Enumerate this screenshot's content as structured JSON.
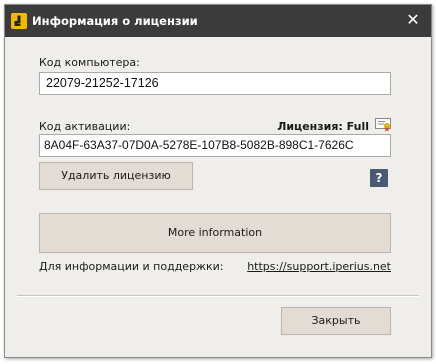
{
  "window": {
    "title": "Информация о лицензии",
    "close_glyph": "✕"
  },
  "computer_code": {
    "label": "Код компьютера:",
    "value": "22079-21252-17126"
  },
  "activation": {
    "label": "Код активации:",
    "license_status": "Лицензия: Full",
    "value": "8A04F-63A37-07D0A-5278E-107B8-5082B-898C1-7626C"
  },
  "buttons": {
    "remove_license": "Удалить лицензию",
    "help": "?",
    "more_information": "More information",
    "close": "Закрыть"
  },
  "support": {
    "label": "Для информации и поддержки:",
    "link": "https://support.iperius.net"
  },
  "colors": {
    "titlebar": "#3b3b3b",
    "logo": "#f3b900",
    "window_bg": "#f0eeeb",
    "button_bg": "#e2dcd4",
    "help_button": "#4a5a75"
  },
  "icons": {
    "app_logo": "app-logo-icon",
    "close": "close-icon",
    "license_certificate": "certificate-icon",
    "help": "help-icon"
  }
}
